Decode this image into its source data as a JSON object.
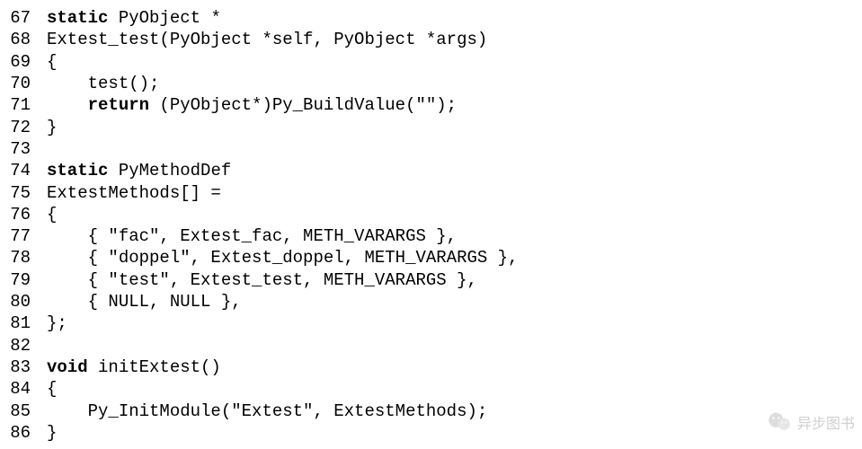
{
  "code": {
    "lines": [
      {
        "n": "67",
        "segments": [
          {
            "t": "static",
            "kw": true
          },
          {
            "t": " PyObject *"
          }
        ]
      },
      {
        "n": "68",
        "segments": [
          {
            "t": "Extest_test(PyObject *self, PyObject *args)"
          }
        ]
      },
      {
        "n": "69",
        "segments": [
          {
            "t": "{"
          }
        ]
      },
      {
        "n": "70",
        "segments": [
          {
            "t": "    test();"
          }
        ]
      },
      {
        "n": "71",
        "segments": [
          {
            "t": "    "
          },
          {
            "t": "return",
            "kw": true
          },
          {
            "t": " (PyObject*)Py_BuildValue(\"\");"
          }
        ]
      },
      {
        "n": "72",
        "segments": [
          {
            "t": "}"
          }
        ]
      },
      {
        "n": "73",
        "segments": [
          {
            "t": ""
          }
        ]
      },
      {
        "n": "74",
        "segments": [
          {
            "t": "static",
            "kw": true
          },
          {
            "t": " PyMethodDef"
          }
        ]
      },
      {
        "n": "75",
        "segments": [
          {
            "t": "ExtestMethods[] ="
          }
        ]
      },
      {
        "n": "76",
        "segments": [
          {
            "t": "{"
          }
        ]
      },
      {
        "n": "77",
        "segments": [
          {
            "t": "    { \"fac\", Extest_fac, METH_VARARGS },"
          }
        ]
      },
      {
        "n": "78",
        "segments": [
          {
            "t": "    { \"doppel\", Extest_doppel, METH_VARARGS },"
          }
        ]
      },
      {
        "n": "79",
        "segments": [
          {
            "t": "    { \"test\", Extest_test, METH_VARARGS },"
          }
        ]
      },
      {
        "n": "80",
        "segments": [
          {
            "t": "    { NULL, NULL },"
          }
        ]
      },
      {
        "n": "81",
        "segments": [
          {
            "t": "};"
          }
        ]
      },
      {
        "n": "82",
        "segments": [
          {
            "t": ""
          }
        ]
      },
      {
        "n": "83",
        "segments": [
          {
            "t": "void",
            "kw": true
          },
          {
            "t": " initExtest()"
          }
        ]
      },
      {
        "n": "84",
        "segments": [
          {
            "t": "{"
          }
        ]
      },
      {
        "n": "85",
        "segments": [
          {
            "t": "    Py_InitModule(\"Extest\", ExtestMethods);"
          }
        ]
      },
      {
        "n": "86",
        "segments": [
          {
            "t": "}"
          }
        ]
      }
    ]
  },
  "watermark": {
    "text": "异步图书"
  }
}
